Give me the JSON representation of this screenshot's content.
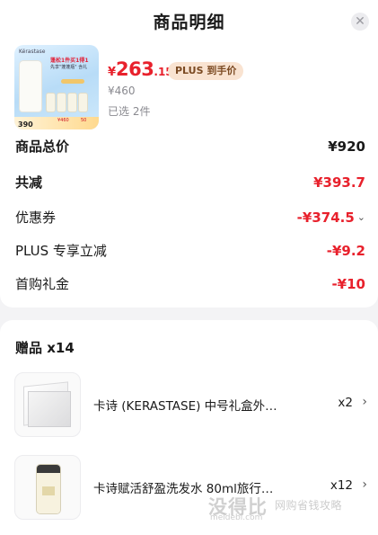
{
  "header": {
    "title": "商品明细"
  },
  "product": {
    "price_currency": "¥",
    "price_int": "263",
    "price_dec": ".15",
    "plus_badge": "PLUS 到手价",
    "original_price": "¥460",
    "selected_count": "已选 2件",
    "thumb": {
      "brand": "Kérastase",
      "ad_line1": "蓬松1件买1得1",
      "ad_line2": "先享\"蓬蓬瓶\" 含礼",
      "price_badge": "390",
      "tag_left": "¥460",
      "tag_right": "50"
    }
  },
  "summary": {
    "total_label": "商品总价",
    "total_value": "¥920",
    "discount_label": "共减",
    "discount_value": "¥393.7",
    "coupon_label": "优惠券",
    "coupon_value": "-¥374.5",
    "plus_label": "PLUS 专享立减",
    "plus_value": "-¥9.2",
    "first_label": "首购礼金",
    "first_value": "-¥10"
  },
  "gifts": {
    "title": "赠品 x14",
    "items": [
      {
        "name": "卡诗 (KERASTASE) 中号礼盒外…",
        "qty": "x2"
      },
      {
        "name": "卡诗赋活舒盈洗发水 80ml旅行…",
        "qty": "x12"
      }
    ]
  },
  "watermark": {
    "logo": "没得比",
    "site": "meidebi.com",
    "slogan": "网购省钱攻略"
  },
  "colors": {
    "price_red": "#e8212c",
    "plus_badge_bg": "#f9e3d1",
    "plus_badge_text": "#7b4a22"
  },
  "icons": [
    "close-icon",
    "chevron-down-icon",
    "chevron-right-icon"
  ]
}
